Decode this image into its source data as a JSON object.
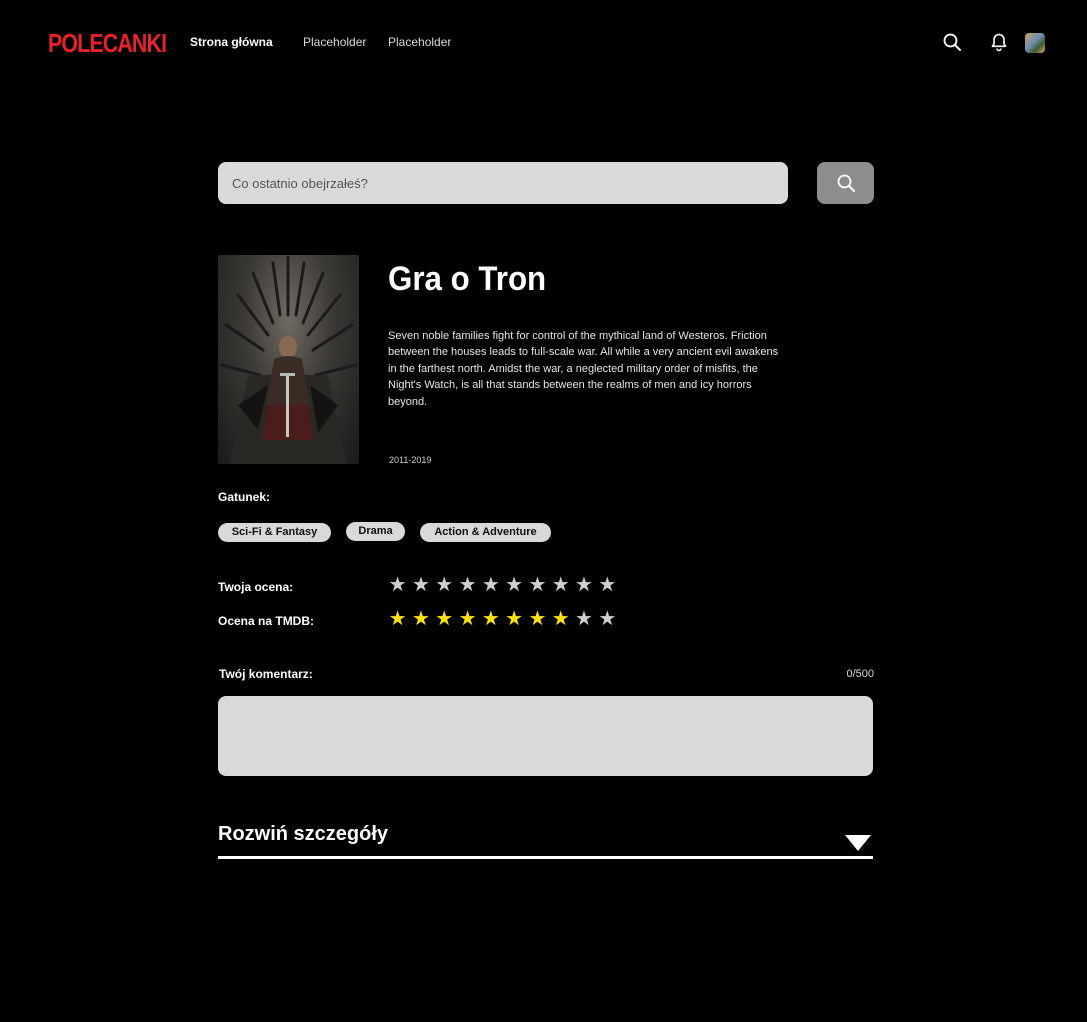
{
  "header": {
    "logo": "POLECANKI",
    "nav": [
      {
        "label": "Strona główna"
      },
      {
        "label": "Placeholder"
      },
      {
        "label": "Placeholder"
      }
    ],
    "icons": [
      "search-icon",
      "bell-icon",
      "avatar"
    ]
  },
  "search": {
    "placeholder": "Co ostatnio obejrzałeś?",
    "value": ""
  },
  "show": {
    "title": "Gra o Tron",
    "description": "Seven noble families fight for control of the mythical land of Westeros. Friction between the houses leads to full-scale war. All while a very ancient evil awakens in the farthest north. Amidst the war, a neglected military order of misfits, the Night's Watch, is all that stands between the realms of men and icy horrors beyond.",
    "years": "2011-2019"
  },
  "genres": {
    "label": "Gatunek:",
    "items": [
      "Sci-Fi & Fantasy",
      "Drama",
      "Action & Adventure"
    ]
  },
  "ratings": {
    "user": {
      "label": "Twoja ocena:",
      "value": 0,
      "max": 10
    },
    "tmdb": {
      "label": "Ocena na TMDB:",
      "value": 8,
      "max": 10
    }
  },
  "comment": {
    "label": "Twój komentarz:",
    "counter": "0/500",
    "value": ""
  },
  "details": {
    "label": "Rozwiń szczegóły"
  },
  "colors": {
    "logo": "#e8222a",
    "star_filled": "#ffe014",
    "star_empty": "#cfcfcf",
    "input_bg": "#d9d9d9",
    "search_button_bg": "#8d8d8d"
  }
}
